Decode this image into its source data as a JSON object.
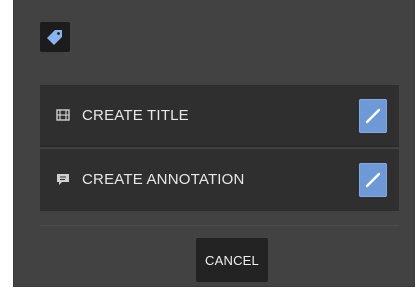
{
  "dialog": {
    "header_icon": "tag-icon",
    "options": [
      {
        "icon": "film-icon",
        "label": "CREATE TITLE",
        "action_icon": "pencil-icon"
      },
      {
        "icon": "comment-icon",
        "label": "CREATE ANNOTATION",
        "action_icon": "pencil-icon"
      }
    ],
    "cancel_label": "CANCEL"
  },
  "colors": {
    "dialog_bg": "#424242",
    "row_bg": "#2f2f2f",
    "accent": "#6f98d6",
    "button_bg": "#232323",
    "text": "#e8e8e8"
  }
}
